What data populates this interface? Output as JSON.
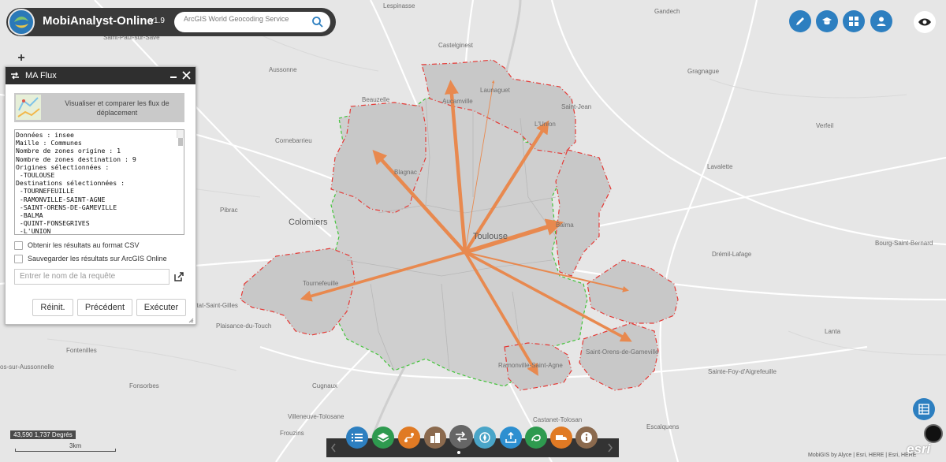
{
  "app": {
    "title": "MobiAnalyst-Online",
    "version": "v1.9",
    "search_placeholder": "ArcGIS World Geocoding Service"
  },
  "header_buttons": [
    {
      "name": "edit-icon"
    },
    {
      "name": "graduation-cap-icon"
    },
    {
      "name": "grid-icon"
    },
    {
      "name": "user-icon"
    }
  ],
  "panel": {
    "title": "MA Flux",
    "banner_text": "Visualiser et comparer les flux de déplacement",
    "info_lines": [
      "Données : insee",
      "Maille : Communes",
      "Nombre de zones origine : 1",
      "Nombre de zones destination : 9",
      "Origines sélectionnées :",
      " -TOULOUSE",
      "Destinations sélectionnées :",
      " -TOURNEFEUILLE",
      " -RAMONVILLE-SAINT-AGNE",
      " -SAINT-ORENS-DE-GAMEVILLE",
      " -BALMA",
      " -QUINT-FONSEGRIVES",
      " -L'UNION"
    ],
    "csv_label": "Obtenir les résultats au format CSV",
    "save_label": "Sauvegarder les résultats sur ArcGIS Online",
    "query_placeholder": "Entrer le nom de la requête",
    "reset_label": "Réinit.",
    "previous_label": "Précédent",
    "execute_label": "Exécuter"
  },
  "places": [
    "Lespinasse",
    "Gandech",
    "Saint-Paul-sur-Save",
    "Castelginest",
    "Aussonne",
    "Gragnague",
    "Launaguet",
    "Beauzelle",
    "Aucamville",
    "Saint-Jean",
    "L'Union",
    "Verfeil",
    "Cornebarrieu",
    "Blagnac",
    "Lavalette",
    "Pibrac",
    "Colomiers",
    "Balma",
    "Toulouse",
    "Bourg-Saint-Bernard",
    "Drémil-Lafage",
    "Tournefeuille",
    "etat-Saint-Gilles",
    "Plaisance-du-Touch",
    "Lanta",
    "Saint-Orens-de-Gameville",
    "Fontenilles",
    "os-sur-Aussonnelle",
    "Ramonville-Saint-Agne",
    "Sainte-Foy-d'Aigrefeuille",
    "Fonsorbes",
    "Cugnaux",
    "Villeneuve-Tolosane",
    "Frouzins",
    "Castanet-Tolosan",
    "Escalquens"
  ],
  "map": {
    "coords": "43,590 1,737 Degrés",
    "scale": "3km",
    "attribution": "MobiGIS by Alyce | Esri, HERE | Esri, HERE",
    "logo": "esri",
    "flow_color": "#e8894f",
    "origin_border_color": "#e53935",
    "destination_border_color": "#43c43a"
  },
  "toolbar": [
    {
      "name": "list-icon",
      "color": "#2d7fc0"
    },
    {
      "name": "layers-icon",
      "color": "#2e9a4f"
    },
    {
      "name": "route-icon",
      "color": "#e07a24"
    },
    {
      "name": "buildings-icon",
      "color": "#8b6a4e"
    },
    {
      "name": "flux-icon",
      "color": "#666666"
    },
    {
      "name": "compass-icon",
      "color": "#4aa5c8"
    },
    {
      "name": "upload-icon",
      "color": "#2d8fd0"
    },
    {
      "name": "ring-icon",
      "color": "#2e9a4f"
    },
    {
      "name": "truck-icon",
      "color": "#e07a24"
    },
    {
      "name": "info-icon",
      "color": "#8b6a4e"
    }
  ]
}
